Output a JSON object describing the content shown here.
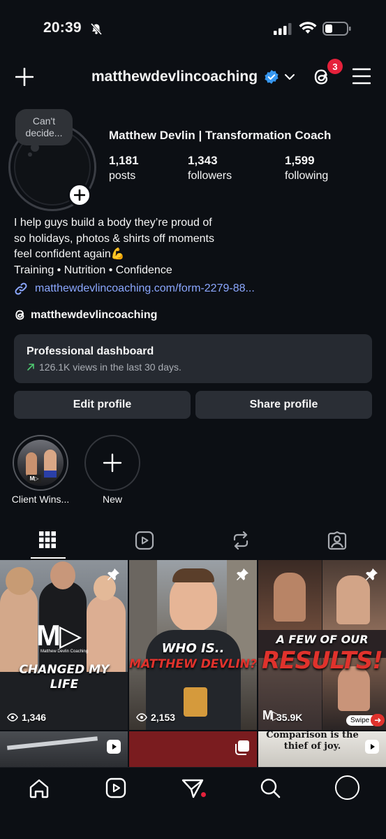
{
  "status_bar": {
    "time": "20:39"
  },
  "header": {
    "username": "matthewdevlincoaching",
    "threads_badge_count": "3"
  },
  "profile": {
    "note": "Can't decide...",
    "full_name": "Matthew Devlin | Transformation Coach",
    "stats": [
      {
        "value": "1,181",
        "label": "posts"
      },
      {
        "value": "1,343",
        "label": "followers"
      },
      {
        "value": "1,599",
        "label": "following"
      }
    ],
    "bio_lines": [
      "I help guys build a body they’re proud of",
      "so holidays, photos & shirts off moments",
      "feel confident again💪",
      "Training • Nutrition • Confidence"
    ],
    "link": "matthewdevlincoaching.com/form-2279-88...",
    "threads_handle": "matthewdevlincoaching"
  },
  "dashboard": {
    "title": "Professional dashboard",
    "subtitle": "126.1K views in the last 30 days."
  },
  "buttons": {
    "edit": "Edit profile",
    "share": "Share profile"
  },
  "highlights": [
    {
      "label": "Client Wins..."
    },
    {
      "label": "New"
    }
  ],
  "posts": [
    {
      "overlay": "CHANGED MY LIFE",
      "brand": "Matthew Devlin Coaching",
      "views": "1,346"
    },
    {
      "overlay_line1": "WHO IS..",
      "overlay_line2": "MATTHEW DEVLIN?",
      "views": "2,153"
    },
    {
      "overlay_line1": "A FEW OF OUR",
      "overlay_line2": "RESULTS!",
      "views": "35.9K",
      "swipe": "Swipe"
    },
    {
      "caption": "Comparison is the thief of joy."
    }
  ],
  "colors": {
    "bg": "#0c0f14",
    "accent_link": "#8ba7ff",
    "badge": "#e5213b",
    "verified": "#3797f0"
  }
}
